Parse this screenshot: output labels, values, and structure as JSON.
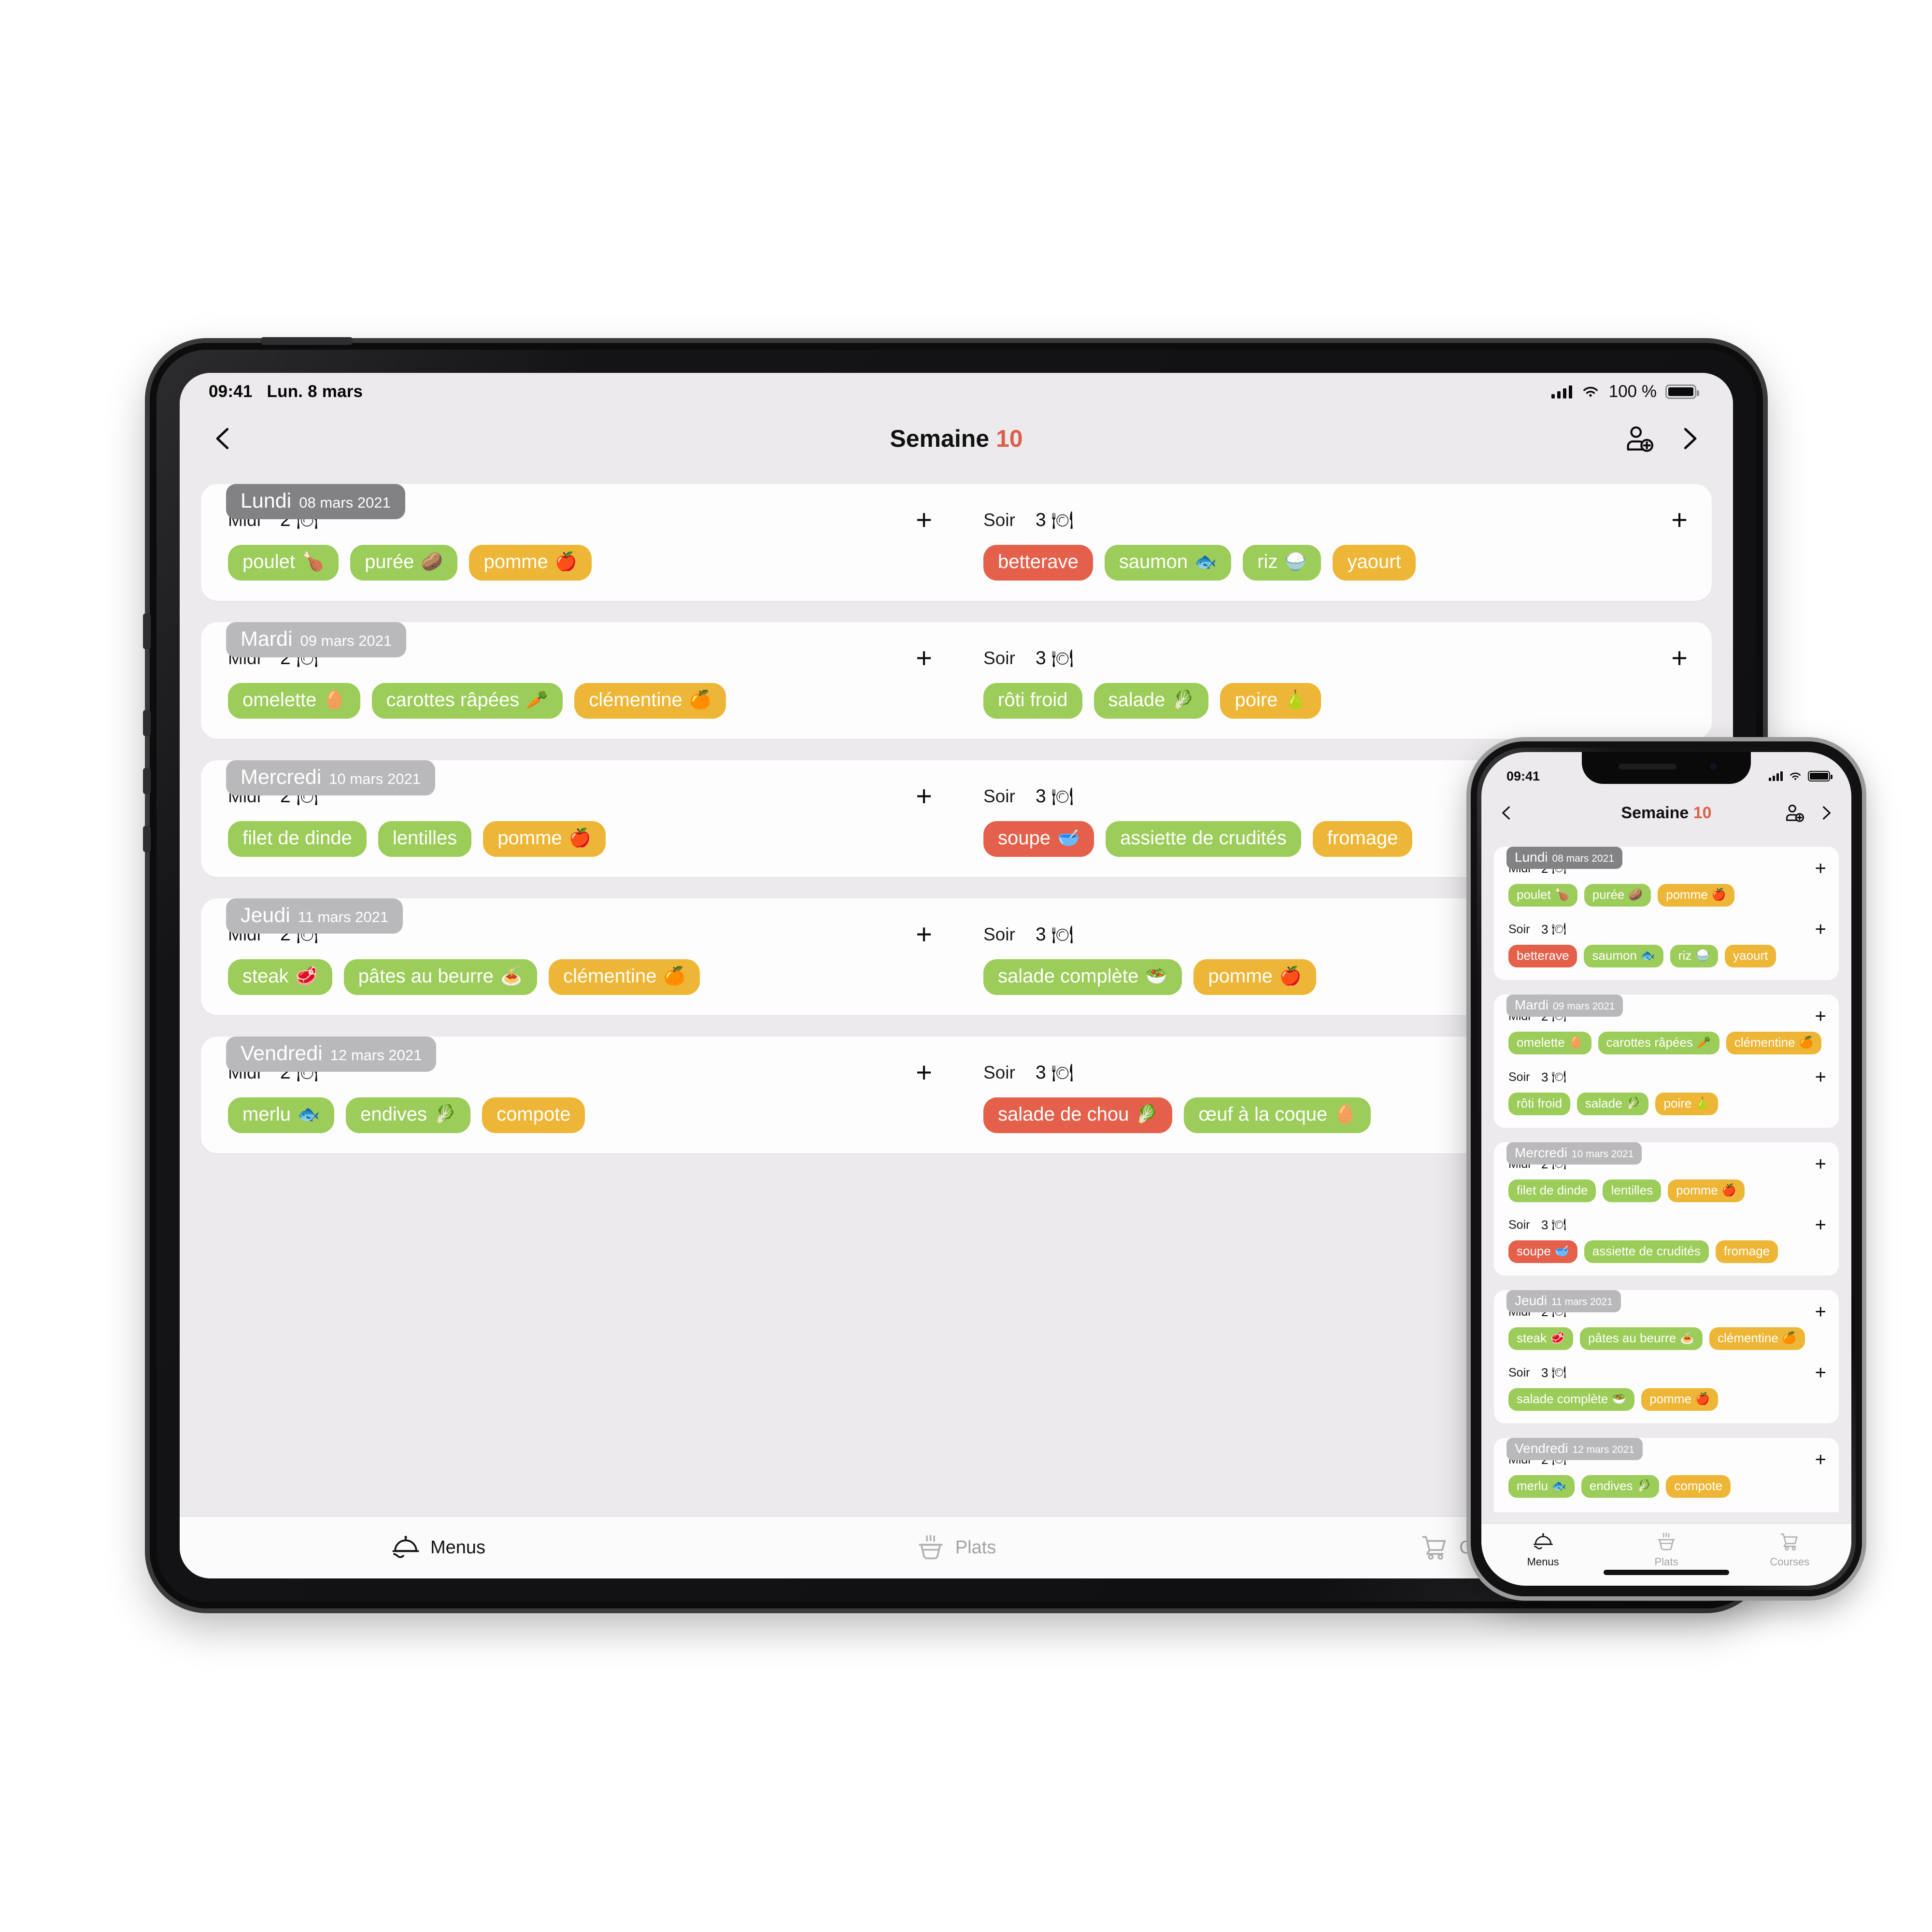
{
  "ipad": {
    "status_bar": {
      "time": "09:41",
      "date": "Lun. 8 mars",
      "battery_percent": "100 %"
    },
    "nav": {
      "title_prefix": "Semaine",
      "week_number": "10",
      "back_icon": "chevron-left-icon",
      "forward_icon": "chevron-right-icon",
      "add_person_icon": "person-add-icon"
    }
  },
  "iphone": {
    "status_bar": {
      "time": "09:41"
    },
    "nav": {
      "title_prefix": "Semaine",
      "week_number": "10"
    }
  },
  "colors": {
    "accent": "#d9604a",
    "chip_green": "#9ccc59",
    "chip_yellow": "#eeb636",
    "chip_red": "#e4604b",
    "badge_dark": "#828284",
    "badge_light": "#b9b9bb"
  },
  "labels": {
    "midi": "Midi",
    "soir": "Soir",
    "add": "+",
    "cutlery": "🍽"
  },
  "tabs": [
    {
      "label": "Menus",
      "icon": "room-service-icon",
      "active": true
    },
    {
      "label": "Plats",
      "icon": "soup-bowl-icon",
      "active": false
    },
    {
      "label": "Courses",
      "icon": "shopping-cart-icon",
      "active": false
    }
  ],
  "days": [
    {
      "name": "Lundi",
      "date": "08 mars 2021",
      "badge": "dark",
      "midi": {
        "label": "Midi",
        "count": "2",
        "chips": [
          {
            "text": "poulet",
            "emoji": "🍗",
            "color": "green"
          },
          {
            "text": "purée",
            "emoji": "🥔",
            "color": "green"
          },
          {
            "text": "pomme",
            "emoji": "🍎",
            "color": "yellow"
          }
        ]
      },
      "soir": {
        "label": "Soir",
        "count": "3",
        "chips": [
          {
            "text": "betterave",
            "emoji": "",
            "color": "red"
          },
          {
            "text": "saumon",
            "emoji": "🐟",
            "color": "green"
          },
          {
            "text": "riz",
            "emoji": "🍚",
            "color": "green"
          },
          {
            "text": "yaourt",
            "emoji": "",
            "color": "yellow"
          }
        ]
      }
    },
    {
      "name": "Mardi",
      "date": "09 mars 2021",
      "badge": "light",
      "midi": {
        "label": "Midi",
        "count": "2",
        "chips": [
          {
            "text": "omelette",
            "emoji": "🥚",
            "color": "green"
          },
          {
            "text": "carottes râpées",
            "emoji": "🥕",
            "color": "green"
          },
          {
            "text": "clémentine",
            "emoji": "🍊",
            "color": "yellow"
          }
        ]
      },
      "soir": {
        "label": "Soir",
        "count": "3",
        "chips": [
          {
            "text": "rôti froid",
            "emoji": "",
            "color": "green"
          },
          {
            "text": "salade",
            "emoji": "🥬",
            "color": "green"
          },
          {
            "text": "poire",
            "emoji": "🍐",
            "color": "yellow"
          }
        ]
      }
    },
    {
      "name": "Mercredi",
      "date": "10 mars 2021",
      "badge": "light",
      "midi": {
        "label": "Midi",
        "count": "2",
        "chips": [
          {
            "text": "filet de dinde",
            "emoji": "",
            "color": "green"
          },
          {
            "text": "lentilles",
            "emoji": "",
            "color": "green"
          },
          {
            "text": "pomme",
            "emoji": "🍎",
            "color": "yellow"
          }
        ]
      },
      "soir": {
        "label": "Soir",
        "count": "3",
        "chips": [
          {
            "text": "soupe",
            "emoji": "🥣",
            "color": "red"
          },
          {
            "text": "assiette de crudités",
            "emoji": "",
            "color": "green"
          },
          {
            "text": "fromage",
            "emoji": "",
            "color": "yellow"
          }
        ]
      }
    },
    {
      "name": "Jeudi",
      "date": "11 mars 2021",
      "badge": "light",
      "midi": {
        "label": "Midi",
        "count": "2",
        "chips": [
          {
            "text": "steak",
            "emoji": "🥩",
            "color": "green"
          },
          {
            "text": "pâtes au beurre",
            "emoji": "🍝",
            "color": "green"
          },
          {
            "text": "clémentine",
            "emoji": "🍊",
            "color": "yellow"
          }
        ]
      },
      "soir": {
        "label": "Soir",
        "count": "3",
        "chips": [
          {
            "text": "salade complète",
            "emoji": "🥗",
            "color": "green"
          },
          {
            "text": "pomme",
            "emoji": "🍎",
            "color": "yellow"
          }
        ]
      }
    },
    {
      "name": "Vendredi",
      "date": "12 mars 2021",
      "badge": "light",
      "midi": {
        "label": "Midi",
        "count": "2",
        "chips": [
          {
            "text": "merlu",
            "emoji": "🐟",
            "color": "green"
          },
          {
            "text": "endives",
            "emoji": "🥬",
            "color": "green"
          },
          {
            "text": "compote",
            "emoji": "",
            "color": "yellow"
          }
        ]
      },
      "soir": {
        "label": "Soir",
        "count": "3",
        "chips": [
          {
            "text": "salade de chou",
            "emoji": "🥬",
            "color": "red"
          },
          {
            "text": "œuf à la coque",
            "emoji": "🥚",
            "color": "green"
          }
        ]
      }
    }
  ]
}
